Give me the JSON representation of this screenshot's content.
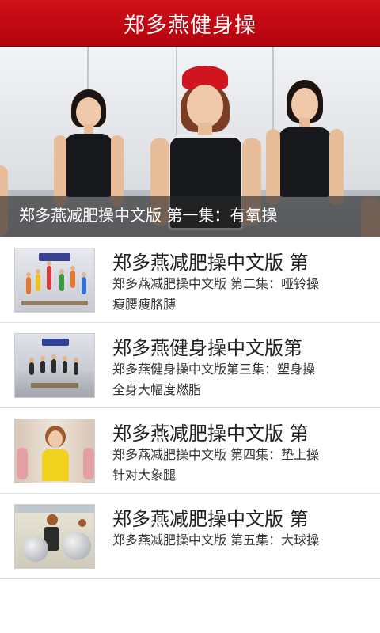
{
  "app": {
    "title": "郑多燕健身操"
  },
  "hero": {
    "caption": "郑多燕减肥操中文版 第一集：有氧操"
  },
  "items": [
    {
      "title": "郑多燕减肥操中文版 第",
      "description": "郑多燕减肥操中文版 第二集：哑铃操 瘦腰瘦胳膊",
      "thumb": "dumbbell-class-thumbnail"
    },
    {
      "title": "郑多燕健身操中文版第",
      "description": "郑多燕健身操中文版第三集：塑身操 全身大幅度燃脂",
      "thumb": "group-class-thumbnail"
    },
    {
      "title": "郑多燕减肥操中文版 第",
      "description": "郑多燕减肥操中文版 第四集：垫上操 针对大象腿",
      "thumb": "instructor-thumbnail"
    },
    {
      "title": "郑多燕减肥操中文版 第",
      "description": "郑多燕减肥操中文版 第五集：大球操",
      "thumb": "exercise-ball-thumbnail"
    }
  ],
  "colors": {
    "titlebar": "#c0060f",
    "text": "#222222",
    "divider": "#e0e0e0"
  }
}
